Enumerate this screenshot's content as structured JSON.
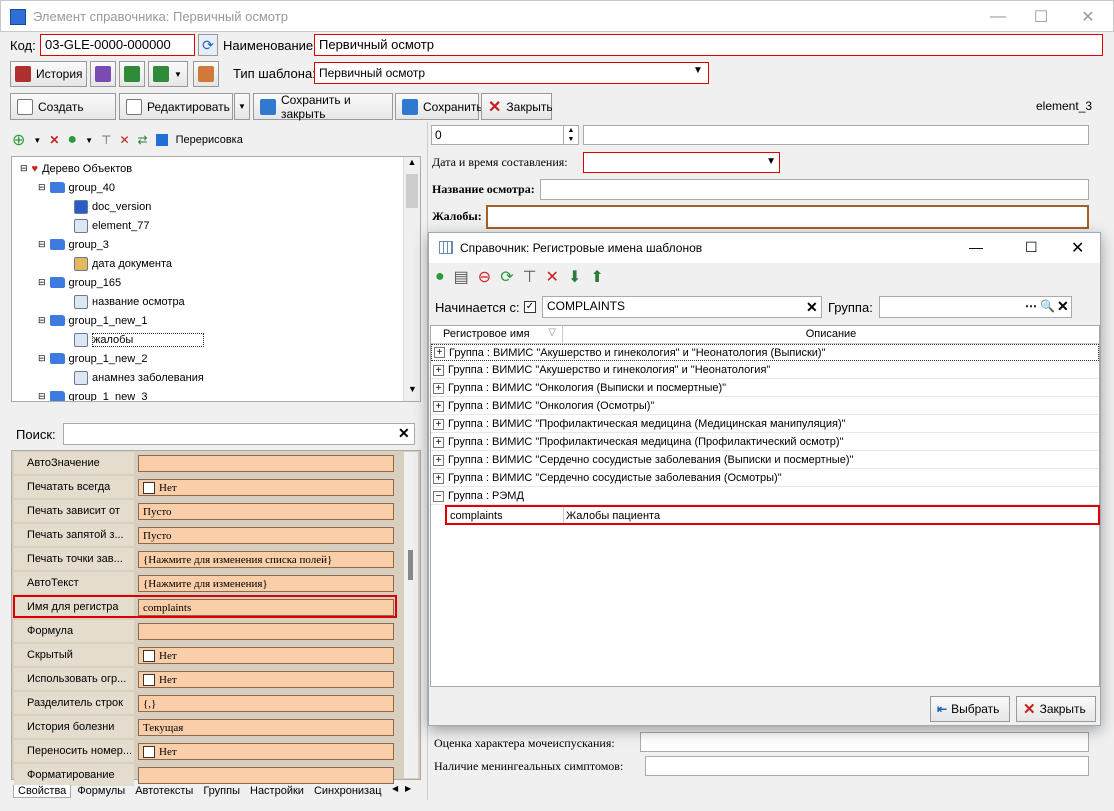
{
  "window": {
    "title": "Элемент справочника: Первичный осмотр",
    "minimize": "—",
    "maximize": "☐",
    "close": "✕"
  },
  "top": {
    "code_label": "Код:",
    "code_value": "03-GLE-0000-000000",
    "name_label": "Наименование:",
    "name_value": "Первичный осмотр",
    "history_label": "История",
    "template_type_label": "Тип шаблона:",
    "template_type_value": "Первичный осмотр"
  },
  "toolbar": {
    "create": "Создать",
    "edit": "Редактировать",
    "save_close": "Сохранить и закрыть",
    "save": "Сохранить",
    "close": "Закрыть",
    "element_id": "element_3"
  },
  "tree_toolbar": {
    "redraw_label": "Перерисовка"
  },
  "tree": {
    "root": "Дерево Объектов",
    "items": [
      {
        "label": "group_40",
        "type": "folder",
        "level": 1
      },
      {
        "label": "doc_version",
        "type": "number",
        "level": 2
      },
      {
        "label": "element_77",
        "type": "element",
        "level": 2
      },
      {
        "label": "group_3",
        "type": "folder",
        "level": 1
      },
      {
        "label": "дата документа",
        "type": "date",
        "level": 2
      },
      {
        "label": "group_165",
        "type": "folder",
        "level": 1
      },
      {
        "label": "название осмотра",
        "type": "doc",
        "level": 2
      },
      {
        "label": "group_1_new_1",
        "type": "folder",
        "level": 1
      },
      {
        "label": "жалобы",
        "type": "text",
        "level": 2
      },
      {
        "label": "group_1_new_2",
        "type": "folder",
        "level": 1
      },
      {
        "label": "анамнез заболевания",
        "type": "text",
        "level": 2
      },
      {
        "label": "group_1_new_3",
        "type": "folder",
        "level": 1
      }
    ]
  },
  "search": {
    "label": "Поиск:",
    "value": ""
  },
  "properties": [
    {
      "name": "АвтоЗначение",
      "value": ""
    },
    {
      "name": "Печатать всегда",
      "value": "Нет",
      "checkbox": true
    },
    {
      "name": "Печать зависит от",
      "value": "Пусто"
    },
    {
      "name": "Печать запятой з...",
      "value": "Пусто"
    },
    {
      "name": "Печать точки зав...",
      "value": "{Нажмите для изменения списка полей}"
    },
    {
      "name": "АвтоТекст",
      "value": "{Нажмите для изменения}"
    },
    {
      "name": "Имя для регистра",
      "value": "complaints",
      "highlight": true
    },
    {
      "name": "Формула",
      "value": ""
    },
    {
      "name": "Скрытый",
      "value": "Нет",
      "checkbox": true
    },
    {
      "name": "Использовать огр...",
      "value": "Нет",
      "checkbox": true
    },
    {
      "name": "Разделитель строк",
      "value": "{,}"
    },
    {
      "name": "История болезни",
      "value": "Текущая"
    },
    {
      "name": "Переносить номер...",
      "value": "Нет",
      "checkbox": true
    },
    {
      "name": "Форматирование",
      "value": ""
    }
  ],
  "bottom_tabs": [
    "Свойства",
    "Формулы",
    "Автотексты",
    "Группы",
    "Настройки",
    "Синхронизац"
  ],
  "right": {
    "spin_value": "0",
    "date_label": "Дата и время составления:",
    "exam_name_label": "Название осмотра:",
    "complaints_label": "Жалобы:",
    "urination_label": "Оценка характера мочеиспускания:",
    "meningeal_label": "Наличие менингеальных симптомов:"
  },
  "dialog": {
    "title": "Справочник: Регистровые имена шаблонов",
    "starts_with_label": "Начинается с:",
    "starts_with_value": "COMPLAINTS",
    "group_label": "Группа:",
    "group_value": "",
    "col_reg_name": "Регистровое имя",
    "col_description": "Описание",
    "groups": [
      "Группа : ВИМИС \"Акушерство и гинекология\" и \"Неонатология (Выписки)\"",
      "Группа : ВИМИС \"Акушерство и гинекология\" и \"Неонатология\"",
      "Группа : ВИМИС \"Онкология (Выписки и посмертные)\"",
      "Группа : ВИМИС \"Онкология (Осмотры)\"",
      "Группа : ВИМИС \"Профилактическая медицина (Медицинская манипуляция)\"",
      "Группа : ВИМИС \"Профилактическая медицина (Профилактический осмотр)\"",
      "Группа : ВИМИС \"Сердечно сосудистые заболевания (Выписки и посмертные)\"",
      "Группа : ВИМИС \"Сердечно сосудистые заболевания (Осмотры)\""
    ],
    "expanded_group": "Группа : РЭМД",
    "row": {
      "reg_name": "complaints",
      "description": "Жалобы пациента"
    },
    "select_button": "Выбрать",
    "close_button": "Закрыть"
  }
}
